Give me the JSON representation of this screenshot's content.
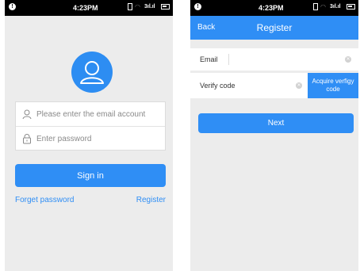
{
  "status_bar": {
    "time": "4:23PM",
    "icons": [
      "notification-icon",
      "vibrate-icon",
      "wifi-icon",
      "signal-icon",
      "battery-icon"
    ]
  },
  "login": {
    "avatar_icon": "user-avatar-icon",
    "email_placeholder": "Please enter the email account",
    "password_placeholder": "Enter password",
    "sign_in_label": "Sign in",
    "forget_password_label": "Forget password",
    "register_label": "Register"
  },
  "register": {
    "back_label": "Back",
    "title": "Register",
    "email_label": "Email",
    "email_value": "",
    "verify_label": "Verify code",
    "verify_value": "",
    "acquire_label": "Acquire verfigy code",
    "next_label": "Next"
  },
  "colors": {
    "accent": "#2f8ef5",
    "background": "#ececec",
    "status_bar": "#000000"
  }
}
